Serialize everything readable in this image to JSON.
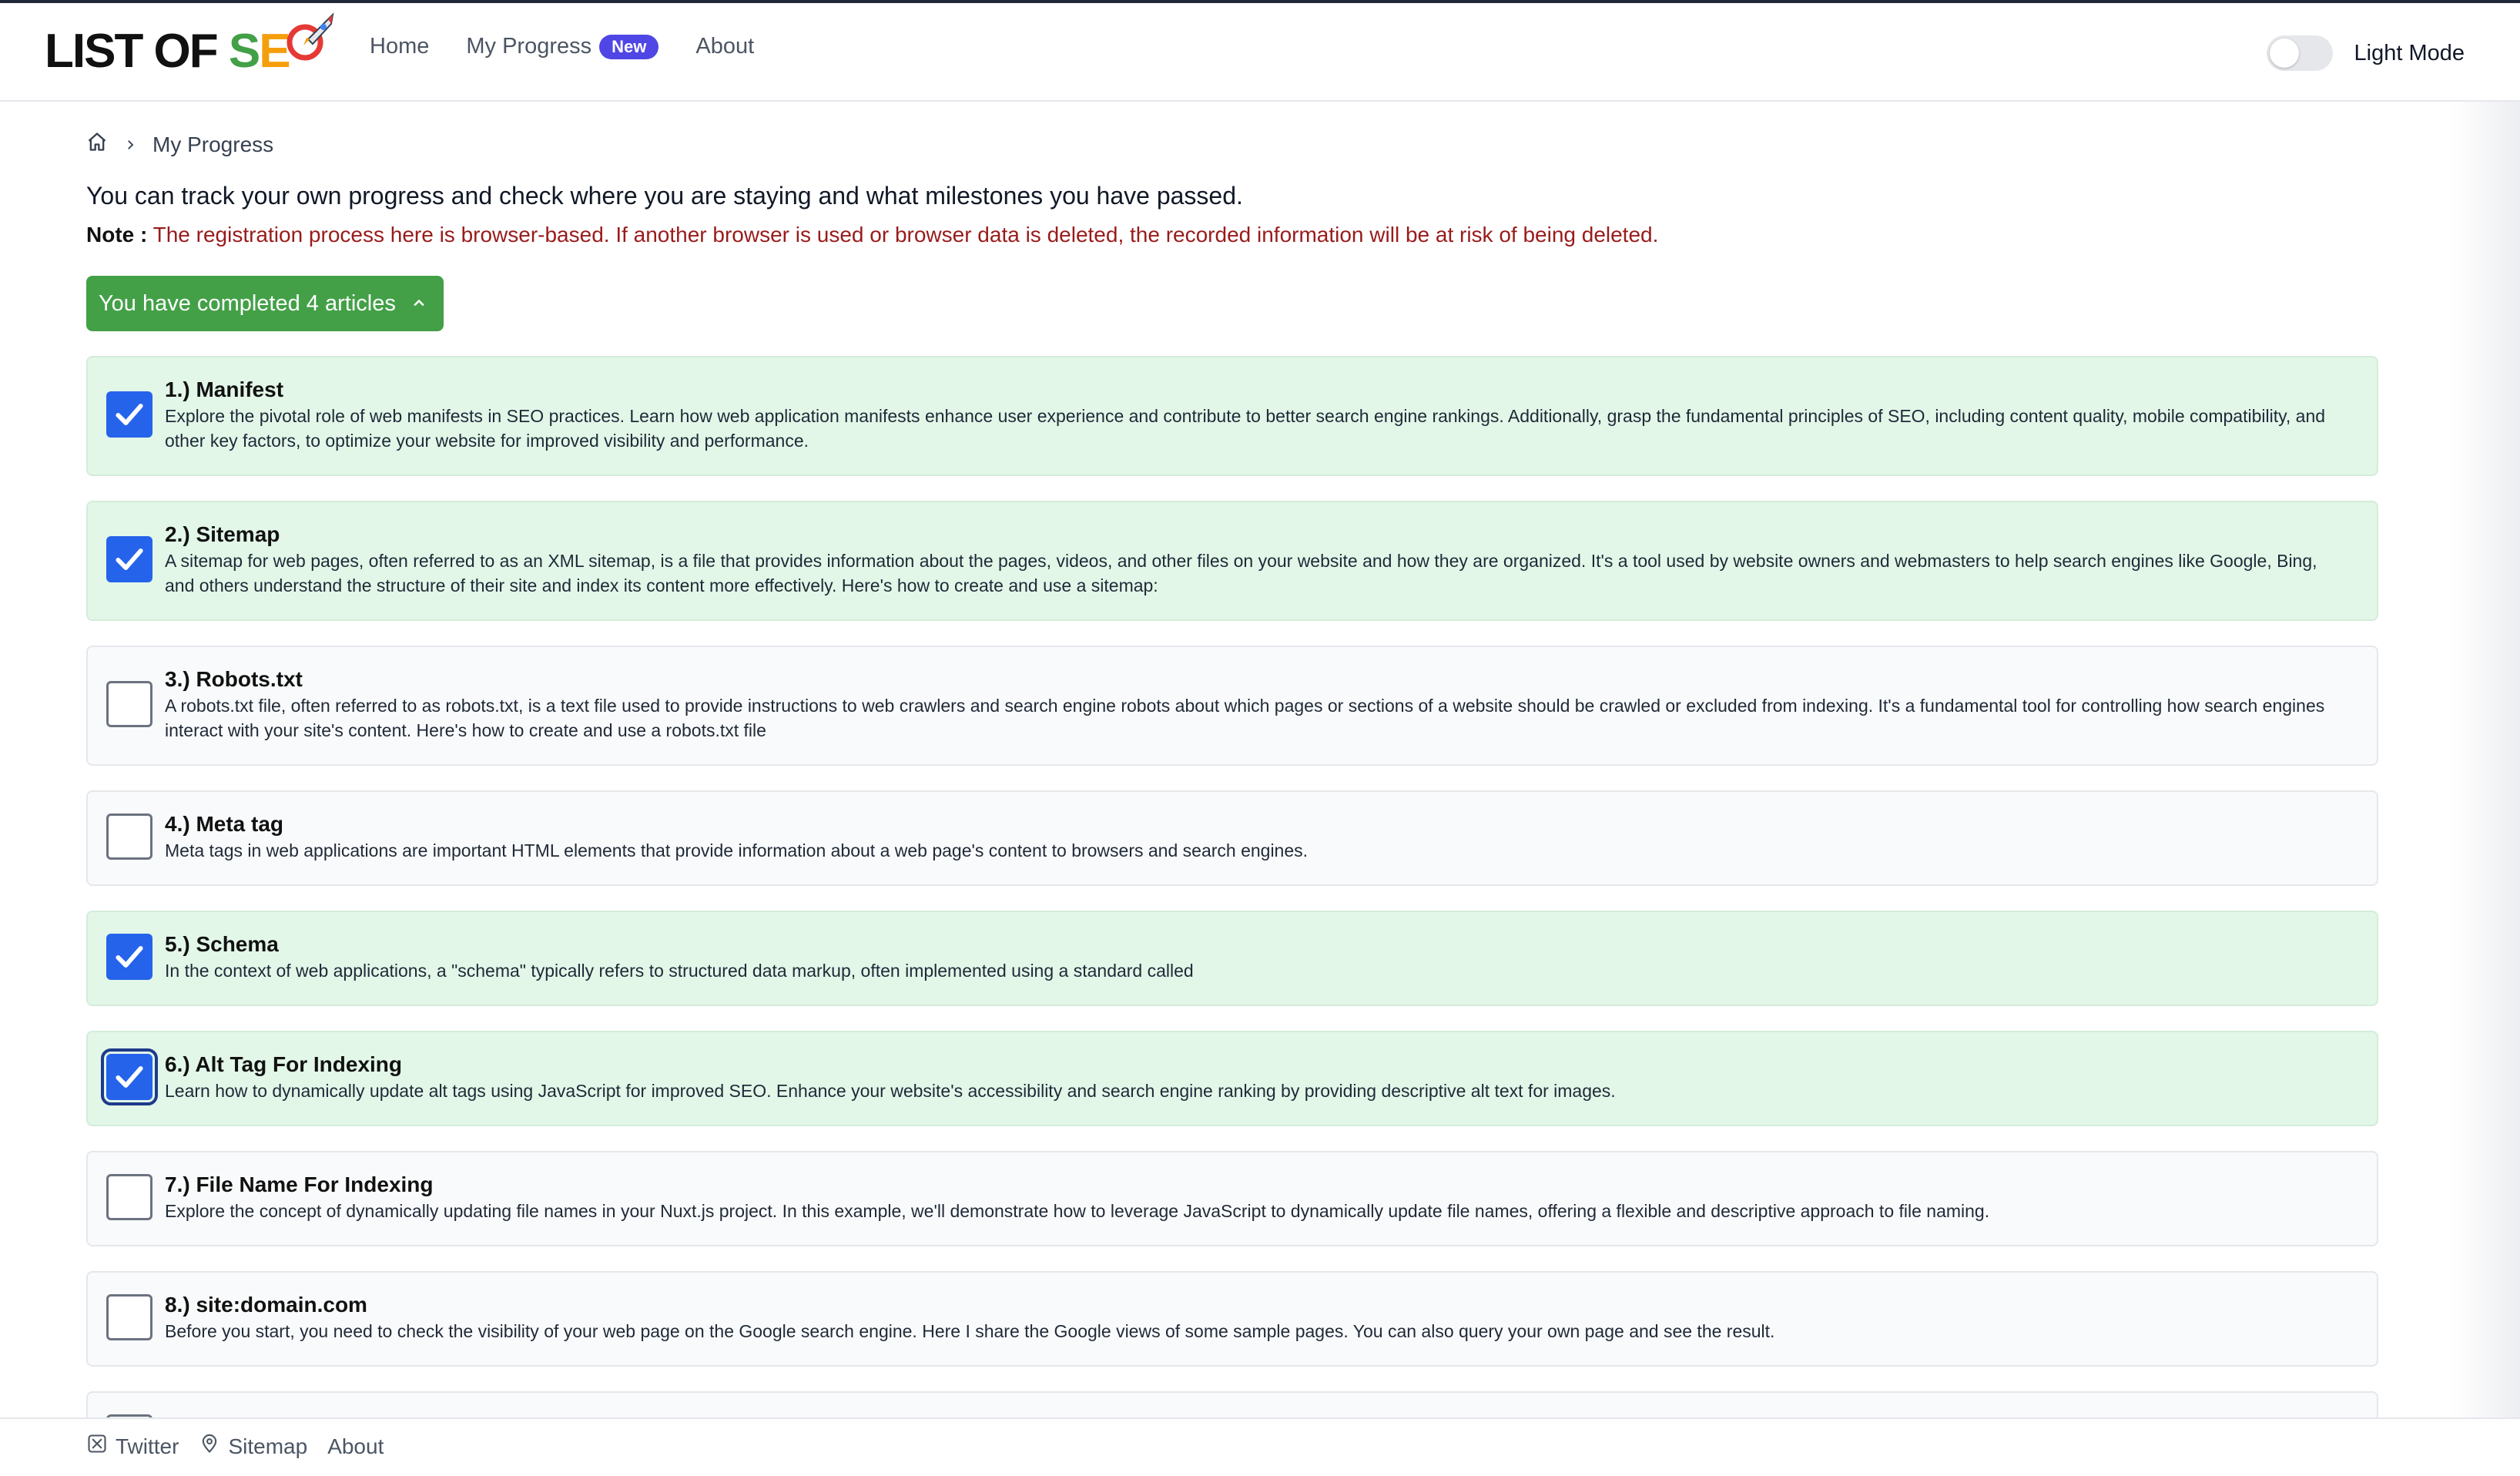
{
  "header": {
    "logo_prefix": "LIST OF ",
    "logo_s": "S",
    "logo_e": "E",
    "nav": [
      {
        "label": "Home"
      },
      {
        "label": "My Progress",
        "badge": "New"
      },
      {
        "label": "About"
      }
    ],
    "theme_label": "Light Mode",
    "theme_on": false
  },
  "breadcrumb": {
    "current": "My Progress"
  },
  "intro": "You can track your own progress and check where you are staying and what milestones you have passed.",
  "note": {
    "label": "Note :",
    "text": "The registration process here is browser-based. If another browser is used or browser data is deleted, the recorded information will be at risk of being deleted."
  },
  "completed_button": "You have completed 4 articles",
  "articles": [
    {
      "title": "1.) Manifest",
      "checked": true,
      "desc": "Explore the pivotal role of web manifests in SEO practices. Learn how web application manifests enhance user experience and contribute to better search engine rankings. Additionally, grasp the fundamental principles of SEO, including content quality, mobile compatibility, and other key factors, to optimize your website for improved visibility and performance."
    },
    {
      "title": "2.) Sitemap",
      "checked": true,
      "desc": "A sitemap for web pages, often referred to as an XML sitemap, is a file that provides information about the pages, videos, and other files on your website and how they are organized. It's a tool used by website owners and webmasters to help search engines like Google, Bing, and others understand the structure of their site and index its content more effectively. Here's how to create and use a sitemap:"
    },
    {
      "title": "3.) Robots.txt",
      "checked": false,
      "desc": "A robots.txt file, often referred to as robots.txt, is a text file used to provide instructions to web crawlers and search engine robots about which pages or sections of a website should be crawled or excluded from indexing. It's a fundamental tool for controlling how search engines interact with your site's content. Here's how to create and use a robots.txt file"
    },
    {
      "title": "4.) Meta tag",
      "checked": false,
      "desc": "Meta tags in web applications are important HTML elements that provide information about a web page's content to browsers and search engines."
    },
    {
      "title": "5.) Schema",
      "checked": true,
      "desc": "In the context of web applications, a \"schema\" typically refers to structured data markup, often implemented using a standard called"
    },
    {
      "title": "6.) Alt Tag For Indexing",
      "checked": true,
      "focused": true,
      "desc": "Learn how to dynamically update alt tags using JavaScript for improved SEO. Enhance your website's accessibility and search engine ranking by providing descriptive alt text for images."
    },
    {
      "title": "7.) File Name For Indexing",
      "checked": false,
      "desc": "Explore the concept of dynamically updating file names in your Nuxt.js project. In this example, we'll demonstrate how to leverage JavaScript to dynamically update file names, offering a flexible and descriptive approach to file naming."
    },
    {
      "title": "8.) site:domain.com",
      "checked": false,
      "desc": "Before you start, you need to check the visibility of your web page on the Google search engine. Here I share the Google views of some sample pages. You can also query your own page and see the result."
    },
    {
      "title": "",
      "checked": false,
      "desc": ""
    }
  ],
  "footer": {
    "links": [
      {
        "label": "Twitter",
        "icon": "x-icon"
      },
      {
        "label": "Sitemap",
        "icon": "map-pin-icon"
      },
      {
        "label": "About",
        "icon": ""
      }
    ]
  },
  "colors": {
    "done_bg": "#e2f7e8",
    "checkbox_checked": "#2563eb",
    "completed_button": "#43a047",
    "note_text": "#991b1b",
    "badge": "#4f46e5"
  }
}
